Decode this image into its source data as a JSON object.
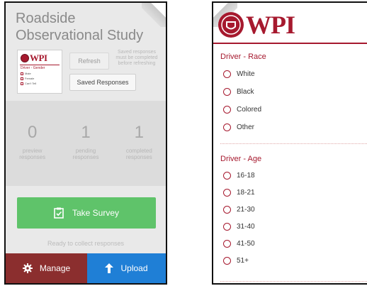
{
  "left": {
    "title": "Roadside Observational Study",
    "thumbnail": {
      "word": "WPI",
      "heading": "Driver - Gender",
      "options": [
        "Male",
        "Female",
        "Can't Tell"
      ]
    },
    "refresh_label": "Refresh",
    "refresh_note": "Saved responses must be completed before refreshing",
    "saved_label": "Saved Responses",
    "stats": [
      {
        "value": "0",
        "label_line1": "preview",
        "label_line2": "responses"
      },
      {
        "value": "1",
        "label_line1": "pending",
        "label_line2": "responses"
      },
      {
        "value": "1",
        "label_line1": "completed",
        "label_line2": "responses"
      }
    ],
    "take_survey_label": "Take Survey",
    "status_text": "Ready to collect responses",
    "manage_label": "Manage",
    "upload_label": "Upload",
    "icons": {
      "take": "clipboard-check-icon",
      "manage": "gear-icon",
      "upload": "arrow-up-icon"
    },
    "colors": {
      "take": "#5fc36a",
      "manage": "#8b2e2e",
      "upload": "#1f7fd6"
    }
  },
  "right": {
    "logo_word": "WPI",
    "accent": "#a6192e",
    "sections": [
      {
        "title": "Driver - Race",
        "options": [
          "White",
          "Black",
          "Colored",
          "Other"
        ]
      },
      {
        "title": "Driver - Age",
        "options": [
          "16-18",
          "18-21",
          "21-30",
          "31-40",
          "41-50",
          "51+"
        ]
      }
    ]
  }
}
